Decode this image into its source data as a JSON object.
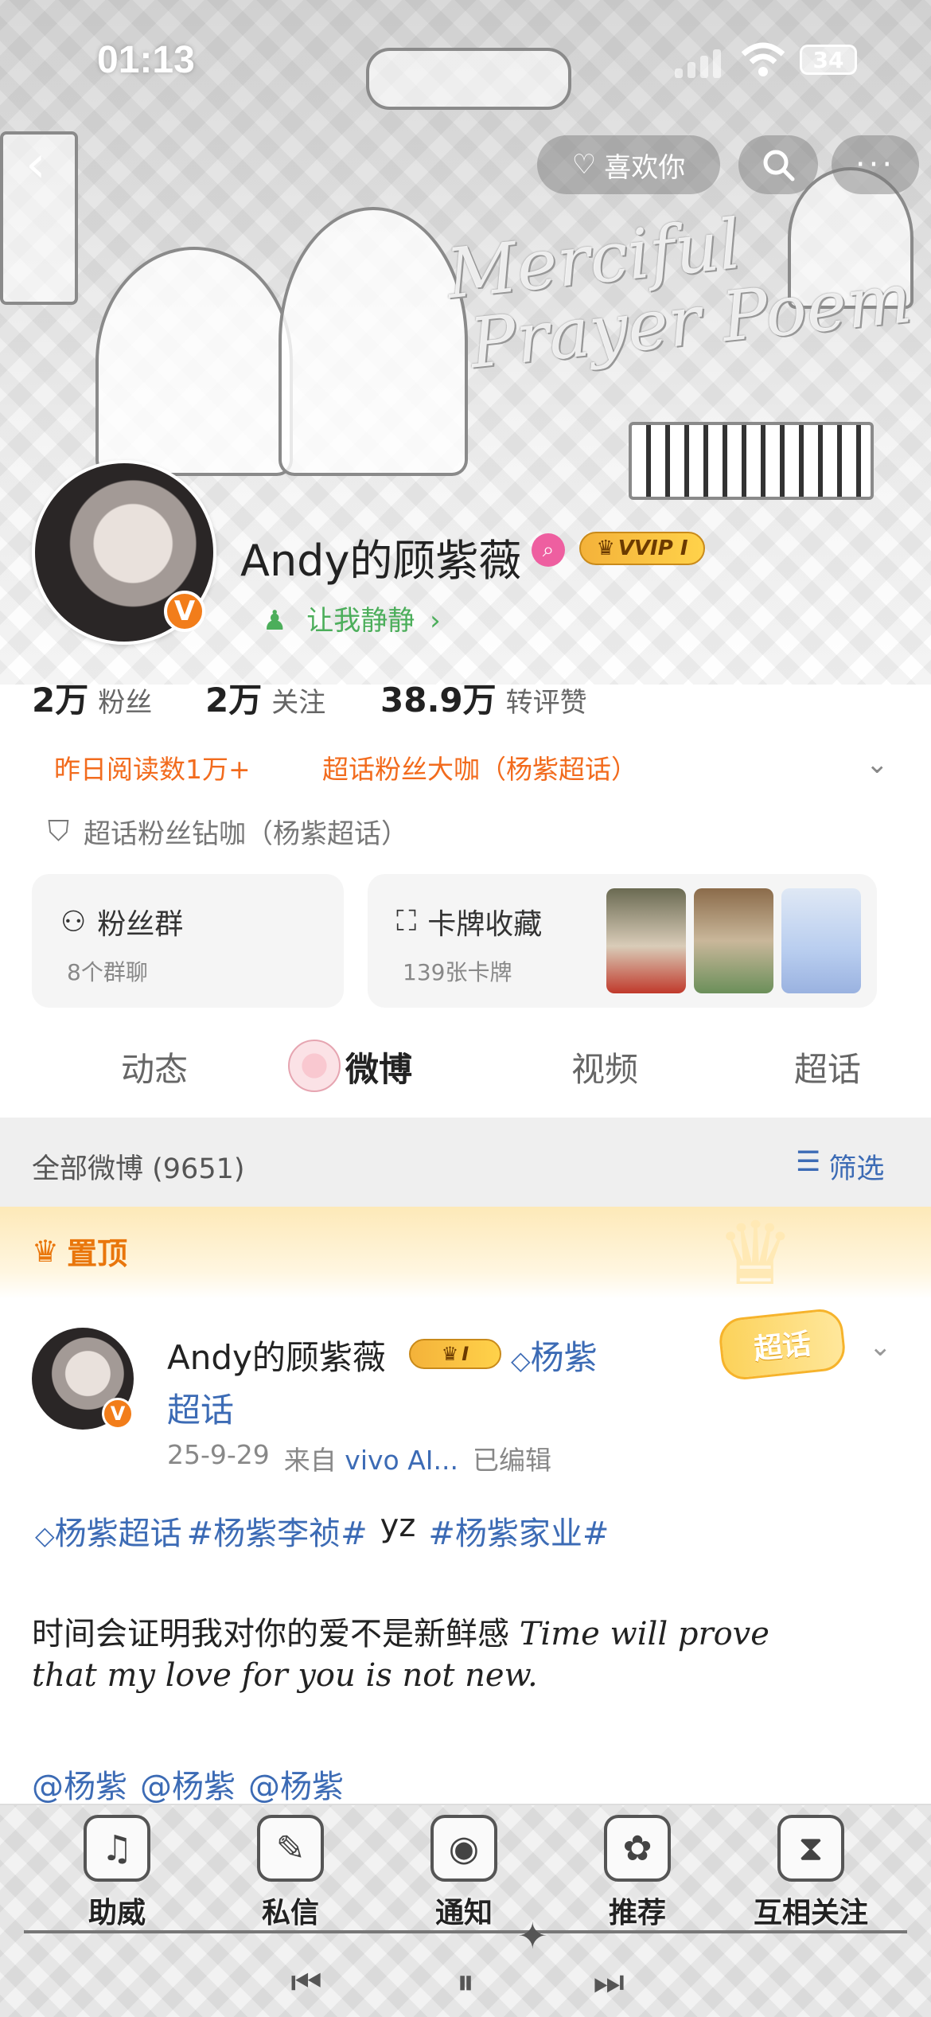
{
  "status_bar": {
    "time": "01:13",
    "battery": "34"
  },
  "header": {
    "like_label": "喜欢你",
    "more_label": "···",
    "deco_title_line1": "Merciful",
    "deco_title_line2": "Prayer Poem"
  },
  "profile": {
    "username": "Andy的顾紫薇",
    "verified": "V",
    "vip_label": "VVIP I",
    "status": "让我静静",
    "stats": [
      {
        "value": "2万",
        "label": "粉丝"
      },
      {
        "value": "2万",
        "label": "关注"
      },
      {
        "value": "38.9万",
        "label": "转评赞"
      }
    ],
    "tag_reads": "昨日阅读数1万+",
    "tag_fan": "超话粉丝大咖（杨紫超话）",
    "badge_line": "超话粉丝钻咖（杨紫超话）"
  },
  "cards": {
    "fans_title": "粉丝群",
    "fans_sub": "8个群聊",
    "collect_title": "卡牌收藏",
    "collect_sub": "139张卡牌"
  },
  "tabs": [
    {
      "label": "动态"
    },
    {
      "label": "微博"
    },
    {
      "label": "视频"
    },
    {
      "label": "超话"
    }
  ],
  "feed": {
    "all_label": "全部微博 (9651)",
    "filter_label": "筛选",
    "pinned_label": "置顶"
  },
  "post": {
    "author": "Andy的顾紫薇",
    "vip_label": "I",
    "topic_part1": "杨紫",
    "topic_part2": "超话",
    "date": "25-9-29",
    "from_label": "来自",
    "source": "vivo AI...",
    "edited": "已编辑",
    "sticker": "超话",
    "tag1": "杨紫超话",
    "tag2": "#杨紫李祯#",
    "tag_plain": "yz",
    "tag3": "#杨紫家业#",
    "text_cn": "时间会证明我对你的爱不是新鲜感",
    "text_en_1": "Time will prove",
    "text_en_2": "that my love for you is not new.",
    "mentions": [
      "@杨紫",
      "@杨紫",
      "@杨紫"
    ]
  },
  "bottom_nav": [
    {
      "label": "助威",
      "icon": "speaker-icon"
    },
    {
      "label": "私信",
      "icon": "microphone-icon"
    },
    {
      "label": "通知",
      "icon": "record-icon"
    },
    {
      "label": "推荐",
      "icon": "rose-icon"
    },
    {
      "label": "互相关注",
      "icon": "hourglass-icon"
    }
  ]
}
